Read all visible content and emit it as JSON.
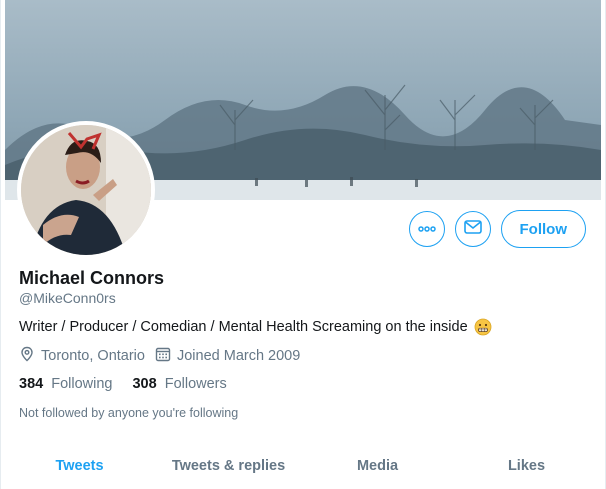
{
  "profile": {
    "name": "Michael Connors",
    "handle": "@MikeConn0rs",
    "bio": "Writer / Producer / Comedian / Mental Health Screaming on the inside",
    "location": "Toronto, Ontario",
    "joined": "Joined March 2009",
    "following_count": "384",
    "following_label": "Following",
    "followers_count": "308",
    "followers_label": "Followers",
    "follow_note": "Not followed by anyone you're following"
  },
  "actions": {
    "follow_label": "Follow",
    "more_icon": "more-options-icon",
    "message_icon": "envelope-icon"
  },
  "tabs": [
    {
      "label": "Tweets",
      "active": true
    },
    {
      "label": "Tweets & replies",
      "active": false
    },
    {
      "label": "Media",
      "active": false
    },
    {
      "label": "Likes",
      "active": false
    }
  ],
  "colors": {
    "accent": "#1da1f2",
    "secondary_text": "#657786",
    "primary_text": "#14171a"
  }
}
